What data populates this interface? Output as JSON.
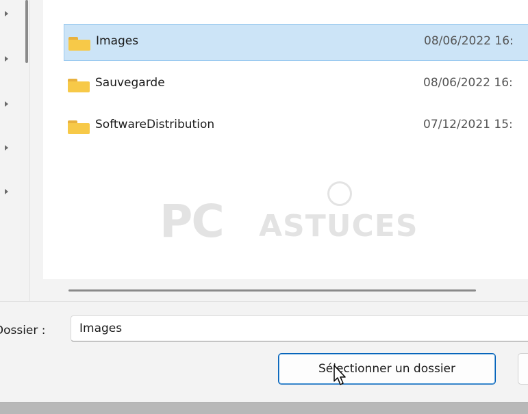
{
  "file_list": {
    "items": [
      {
        "name": "Images",
        "date": "08/06/2022 16:",
        "selected": true
      },
      {
        "name": "Sauvegarde",
        "date": "08/06/2022 16:",
        "selected": false
      },
      {
        "name": "SoftwareDistribution",
        "date": "07/12/2021 15:",
        "selected": false
      }
    ]
  },
  "watermark": {
    "pc": "PC",
    "astuces": "ASTUCES"
  },
  "footer": {
    "folder_label": "Dossier :",
    "folder_value": "Images",
    "select_button_label": "Sélectionner un dossier"
  },
  "colors": {
    "selection_bg": "#cce4f7",
    "selection_border": "#99c9ef",
    "folder_yellow": "#f7c948",
    "accent_blue": "#005fb8"
  },
  "icons": {
    "folder": "folder-icon",
    "cursor": "mouse-pointer-icon",
    "tree_expander": "chevron-right-icon"
  }
}
